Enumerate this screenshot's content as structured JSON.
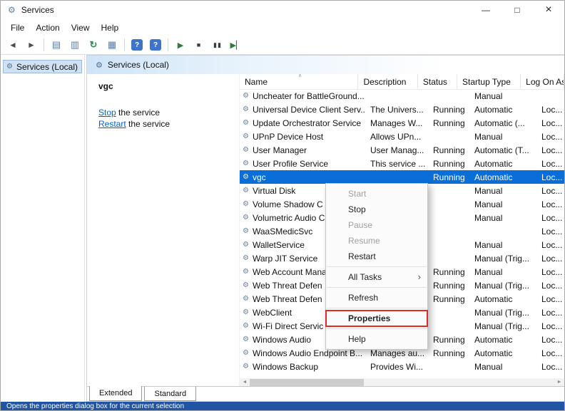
{
  "window": {
    "title": "Services"
  },
  "titlebar": {
    "controls": {
      "minimize": "—",
      "maximize": "□",
      "close": "×"
    }
  },
  "menubar": {
    "items": [
      "File",
      "Action",
      "View",
      "Help"
    ]
  },
  "toolbar": {
    "buttons": [
      {
        "name": "back-button",
        "glyph": "◄",
        "cls": "nav"
      },
      {
        "name": "forward-button",
        "glyph": "►",
        "cls": "nav"
      },
      {
        "type": "sep"
      },
      {
        "name": "show-console-tree-button",
        "glyph": "▤",
        "cls": "doc"
      },
      {
        "name": "export-list-button",
        "glyph": "▥",
        "cls": "doc"
      },
      {
        "name": "refresh-button",
        "glyph": "↻",
        "cls": "refresh"
      },
      {
        "name": "properties-button",
        "glyph": "▦",
        "cls": "doc"
      },
      {
        "type": "sep"
      },
      {
        "name": "help-button",
        "glyph": "?",
        "cls": "help"
      },
      {
        "name": "context-help-button",
        "glyph": "?",
        "cls": "help"
      },
      {
        "type": "sep"
      },
      {
        "name": "start-service-button",
        "glyph": "▶",
        "cls": "play"
      },
      {
        "name": "stop-service-button",
        "glyph": "■",
        "cls": "stopg"
      },
      {
        "name": "pause-service-button",
        "glyph": "▮▮",
        "cls": "stopg"
      },
      {
        "name": "restart-service-button",
        "glyph": "▶▏",
        "cls": "play"
      }
    ]
  },
  "sidebar": {
    "root_label": "Services (Local)"
  },
  "pane": {
    "header": "Services (Local)"
  },
  "detail": {
    "title": "vgc",
    "actions": [
      {
        "link": "Stop",
        "rest": " the service"
      },
      {
        "link": "Restart",
        "rest": " the service"
      }
    ]
  },
  "table": {
    "columns": [
      "Name",
      "Description",
      "Status",
      "Startup Type",
      "Log On As"
    ],
    "rows": [
      {
        "name": "Uncheater for BattleGround...",
        "description": "",
        "status": "",
        "startup": "Manual",
        "logon": ""
      },
      {
        "name": "Universal Device Client Serv...",
        "description": "The Univers...",
        "status": "Running",
        "startup": "Automatic",
        "logon": "Loc..."
      },
      {
        "name": "Update Orchestrator Service",
        "description": "Manages W...",
        "status": "Running",
        "startup": "Automatic (...",
        "logon": "Loc..."
      },
      {
        "name": "UPnP Device Host",
        "description": "Allows UPn...",
        "status": "",
        "startup": "Manual",
        "logon": "Loc..."
      },
      {
        "name": "User Manager",
        "description": "User Manag...",
        "status": "Running",
        "startup": "Automatic (T...",
        "logon": "Loc..."
      },
      {
        "name": "User Profile Service",
        "description": "This service ...",
        "status": "Running",
        "startup": "Automatic",
        "logon": "Loc..."
      },
      {
        "name": "vgc",
        "description": "",
        "status": "Running",
        "startup": "Automatic",
        "logon": "Loc...",
        "selected": true
      },
      {
        "name": "Virtual Disk",
        "description": "",
        "status": "",
        "startup": "Manual",
        "logon": "Loc..."
      },
      {
        "name": "Volume Shadow C",
        "description": "",
        "status": "",
        "startup": "Manual",
        "logon": "Loc..."
      },
      {
        "name": "Volumetric Audio C",
        "description": "",
        "status": "",
        "startup": "Manual",
        "logon": "Loc..."
      },
      {
        "name": "WaaSMedicSvc",
        "description": "",
        "status": "",
        "startup": "",
        "logon": "Loc..."
      },
      {
        "name": "WalletService",
        "description": "",
        "status": "",
        "startup": "Manual",
        "logon": "Loc..."
      },
      {
        "name": "Warp JIT Service",
        "description": "",
        "status": "",
        "startup": "Manual (Trig...",
        "logon": "Loc..."
      },
      {
        "name": "Web Account Mana",
        "description": "",
        "status": "Running",
        "startup": "Manual",
        "logon": "Loc..."
      },
      {
        "name": "Web Threat Defen",
        "description": "",
        "status": "Running",
        "startup": "Manual (Trig...",
        "logon": "Loc..."
      },
      {
        "name": "Web Threat Defen",
        "description": "",
        "status": "Running",
        "startup": "Automatic",
        "logon": "Loc..."
      },
      {
        "name": "WebClient",
        "description": "",
        "status": "",
        "startup": "Manual (Trig...",
        "logon": "Loc..."
      },
      {
        "name": "Wi-Fi Direct Servic",
        "description": "",
        "status": "",
        "startup": "Manual (Trig...",
        "logon": "Loc..."
      },
      {
        "name": "Windows Audio",
        "description": "",
        "status": "Running",
        "startup": "Automatic",
        "logon": "Loc..."
      },
      {
        "name": "Windows Audio Endpoint B...",
        "description": "Manages au...",
        "status": "Running",
        "startup": "Automatic",
        "logon": "Loc..."
      },
      {
        "name": "Windows Backup",
        "description": "Provides Wi...",
        "status": "",
        "startup": "Manual",
        "logon": "Loc..."
      }
    ]
  },
  "context_menu": {
    "items": [
      {
        "name": "start",
        "label": "Start",
        "disabled": true
      },
      {
        "name": "stop",
        "label": "Stop"
      },
      {
        "name": "pause",
        "label": "Pause",
        "disabled": true
      },
      {
        "name": "resume",
        "label": "Resume",
        "disabled": true
      },
      {
        "name": "restart",
        "label": "Restart"
      },
      {
        "type": "separator"
      },
      {
        "name": "all-tasks",
        "label": "All Tasks",
        "submenu": true
      },
      {
        "type": "separator"
      },
      {
        "name": "refresh",
        "label": "Refresh"
      },
      {
        "type": "separator"
      },
      {
        "name": "properties",
        "label": "Properties",
        "annotated": true,
        "bold": true
      },
      {
        "type": "separator"
      },
      {
        "name": "help",
        "label": "Help"
      }
    ]
  },
  "tabs": [
    {
      "label": "Extended",
      "active": true
    },
    {
      "label": "Standard",
      "active": false
    }
  ],
  "statusbar": {
    "text": "Opens the properties dialog box for the current selection"
  },
  "icons": {
    "gear": "⚙",
    "submenu_arrow": "›",
    "sort_caret": "∧",
    "scroll_left": "◄",
    "scroll_right": "►"
  },
  "colors": {
    "selection": "#0a6ed9",
    "annotation": "#df2b22",
    "link": "#0563c1",
    "statusbar_bg": "#2155a4",
    "help_icon_bg": "#3f74c9"
  }
}
